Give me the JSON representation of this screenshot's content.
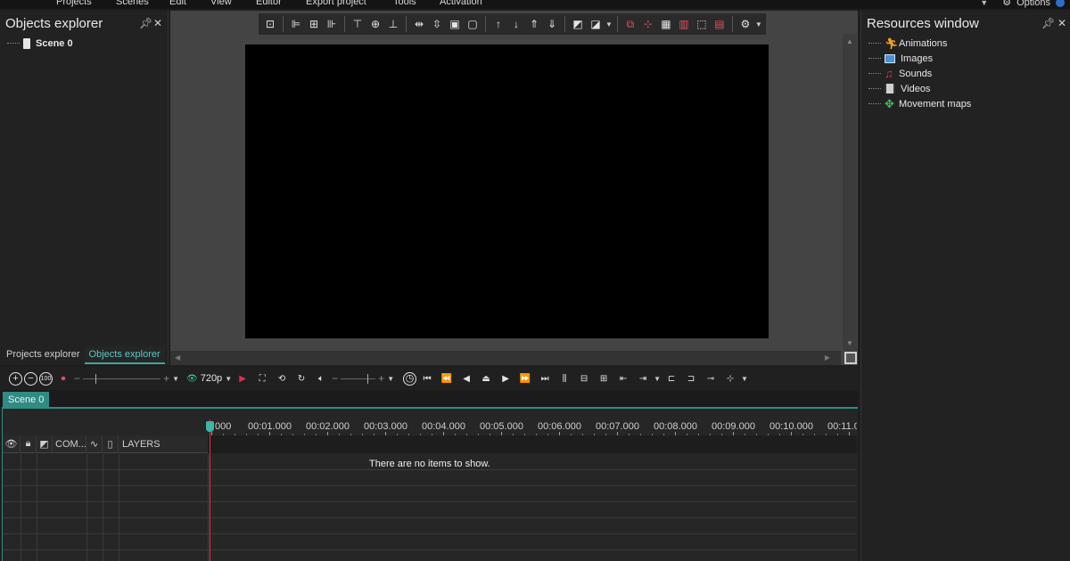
{
  "menu": {
    "items": [
      "Projects",
      "Scenes",
      "Edit",
      "View",
      "Editor",
      "Export project",
      "Tools",
      "Activation"
    ],
    "options_label": "Options"
  },
  "objects_panel": {
    "title": "Objects explorer",
    "tree": [
      {
        "label": "Scene 0",
        "icon": "scene-icon"
      }
    ],
    "tabs": [
      {
        "label": "Projects explorer",
        "active": false
      },
      {
        "label": "Objects explorer",
        "active": true
      }
    ]
  },
  "resources_panel": {
    "title": "Resources window",
    "tree": [
      {
        "label": "Animations",
        "icon": "animation-icon",
        "color": "#f0a020"
      },
      {
        "label": "Images",
        "icon": "image-icon",
        "color": "#4a90d9"
      },
      {
        "label": "Sounds",
        "icon": "music-note-icon",
        "color": "#e0304a"
      },
      {
        "label": "Videos",
        "icon": "film-icon",
        "color": "#d0d0d0"
      },
      {
        "label": "Movement maps",
        "icon": "move-arrows-icon",
        "color": "#40c060"
      }
    ]
  },
  "timeline": {
    "resolution": "720p",
    "scene_tab": "Scene 0",
    "headers": {
      "com": "COM...",
      "layers": "LAYERS"
    },
    "empty_message": "There are no items to show.",
    "ruler_labels": [
      "000",
      "00:01.000",
      "00:02.000",
      "00:03.000",
      "00:04.000",
      "00:05.000",
      "00:06.000",
      "00:07.000",
      "00:08.000",
      "00:09.000",
      "00:10.000",
      "00:11.0"
    ]
  },
  "colors": {
    "accent": "#2f8c83",
    "playhead": "#e03040",
    "background": "#1e1e1e"
  }
}
